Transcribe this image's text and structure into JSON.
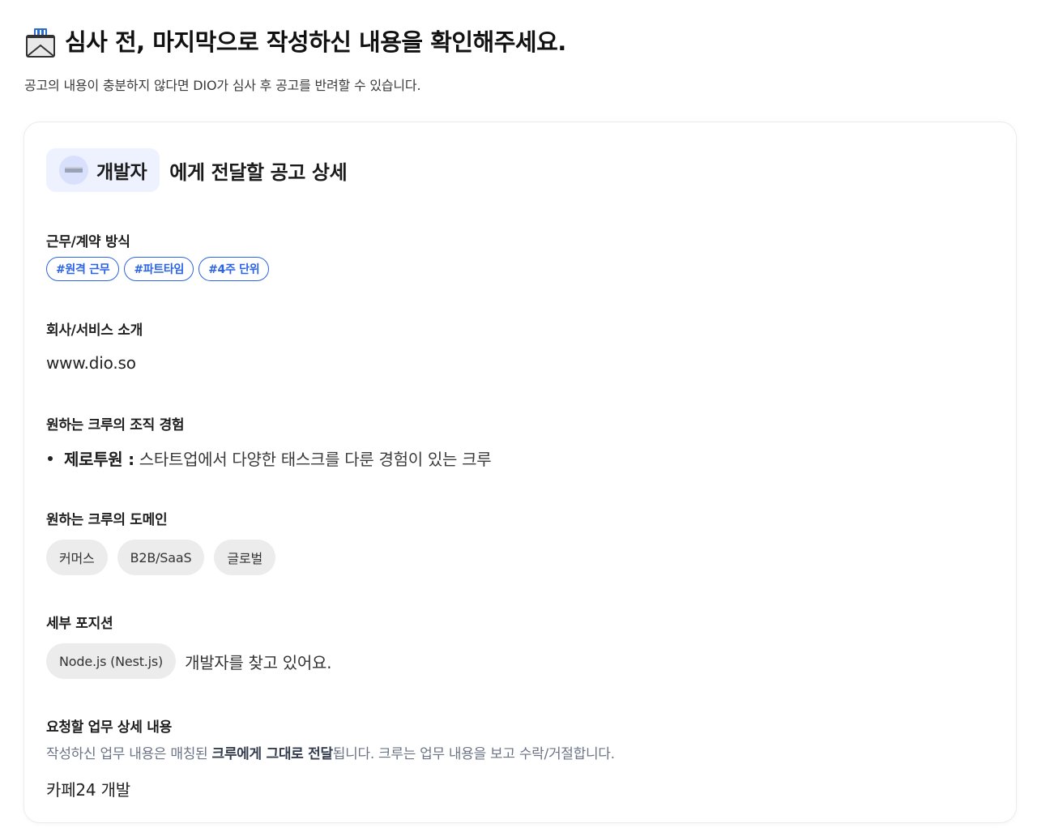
{
  "header": {
    "icon": "envelope-in-tray-icon",
    "title": "심사 전, 마지막으로 작성하신 내용을 확인해주세요.",
    "subtitle": "공고의 내용이 충분하지 않다면 DIO가 심사 후 공고를 반려할 수 있습니다."
  },
  "card": {
    "role": {
      "icon": "keyboard-icon",
      "label": "개발자",
      "suffix": "에게 전달할 공고 상세"
    },
    "work_type": {
      "label": "근무/계약 방식",
      "tags": [
        "#원격 근무",
        "#파트타임",
        "#4주 단위"
      ]
    },
    "company_intro": {
      "label": "회사/서비스 소개",
      "value": "www.dio.so"
    },
    "org_experience": {
      "label": "원하는 크루의 조직 경험",
      "items": [
        {
          "title": "제로투원 :",
          "desc": "스타트업에서 다양한 태스크를 다룬 경험이 있는 크루"
        }
      ]
    },
    "domain": {
      "label": "원하는 크루의 도메인",
      "pills": [
        "커머스",
        "B2B/SaaS",
        "글로벌"
      ]
    },
    "position": {
      "label": "세부 포지션",
      "pill": "Node.js (Nest.js)",
      "text": "개발자를 찾고 있어요."
    },
    "task_detail": {
      "label": "요청할 업무 상세 내용",
      "helper_pre": "작성하신 업무 내용은 매칭된 ",
      "helper_strong": "크루에게 그대로 전달",
      "helper_post": "됩니다. 크루는 업무 내용을 보고 수락/거절합니다.",
      "value": "카페24 개발"
    }
  },
  "colors": {
    "accent": "#2b63e8",
    "role_chip_bg": "#eef2ff",
    "pill_bg": "#ececec"
  }
}
